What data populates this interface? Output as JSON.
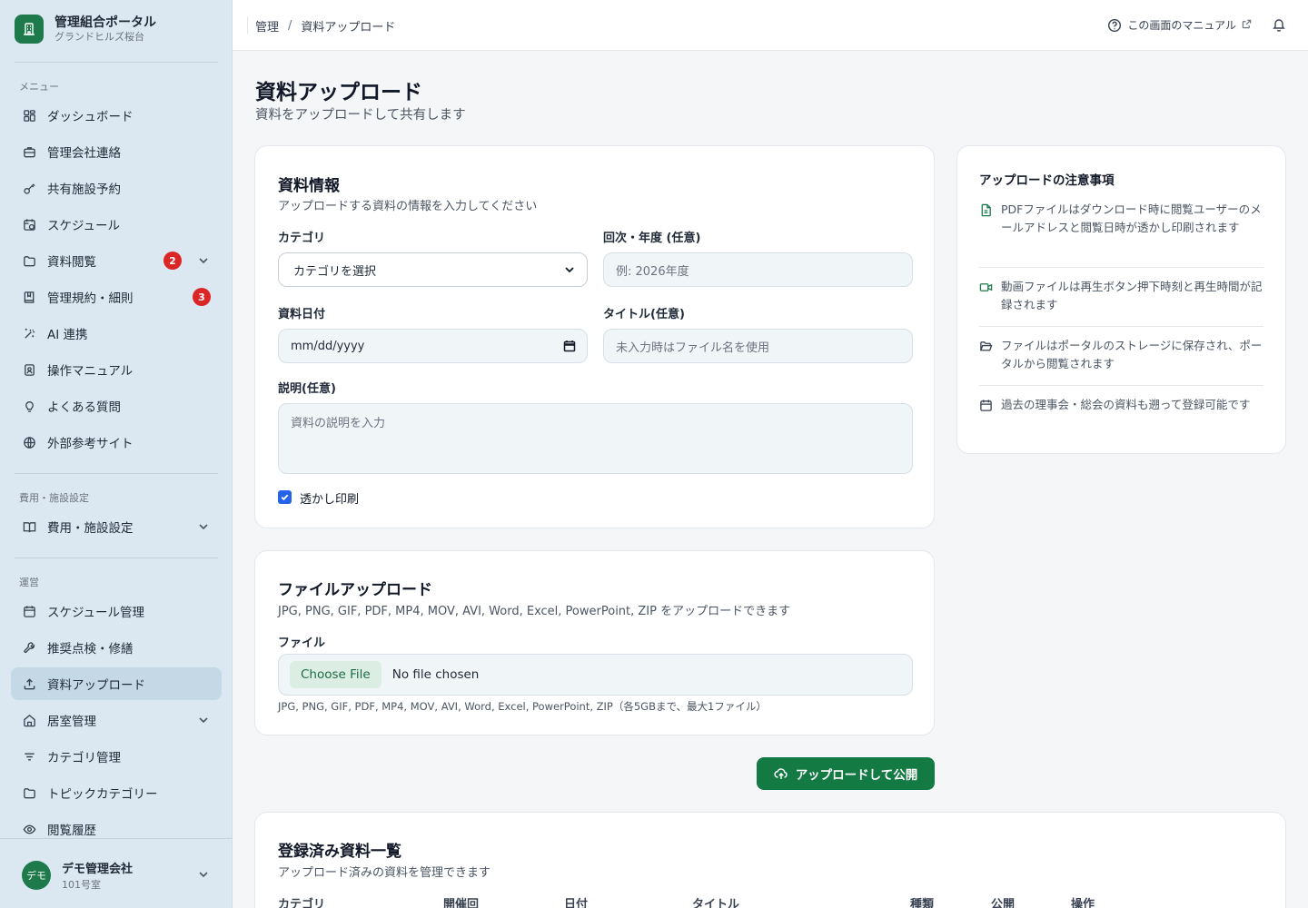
{
  "brand": {
    "title": "管理組合ポータル",
    "subtitle": "グランドヒルズ桜台"
  },
  "sidebar": {
    "section_menu": "メニュー",
    "section_fees": "費用・施設設定",
    "section_ops": "運営",
    "items": [
      {
        "label": "ダッシュボード",
        "icon": "grid-icon"
      },
      {
        "label": "管理会社連絡",
        "icon": "briefcase-icon"
      },
      {
        "label": "共有施設予約",
        "icon": "key-icon"
      },
      {
        "label": "スケジュール",
        "icon": "calendar-clock-icon"
      },
      {
        "label": "資料閲覧",
        "icon": "folder-icon",
        "badge": "2"
      },
      {
        "label": "管理規約・細則",
        "icon": "book-icon",
        "badge": "3"
      },
      {
        "label": "AI 連携",
        "icon": "sparkle-icon"
      },
      {
        "label": "操作マニュアル",
        "icon": "manual-icon"
      },
      {
        "label": "よくある質問",
        "icon": "lightbulb-icon"
      },
      {
        "label": "外部参考サイト",
        "icon": "globe-icon"
      },
      {
        "label": "費用・施設設定",
        "icon": "open-book-icon"
      },
      {
        "label": "スケジュール管理",
        "icon": "calendar-icon"
      },
      {
        "label": "推奨点検・修繕",
        "icon": "wrench-icon"
      },
      {
        "label": "資料アップロード",
        "icon": "upload-icon"
      },
      {
        "label": "居室管理",
        "icon": "home-icon"
      },
      {
        "label": "カテゴリ管理",
        "icon": "filter-icon"
      },
      {
        "label": "トピックカテゴリー",
        "icon": "folder-icon"
      },
      {
        "label": "閲覧履歴",
        "icon": "eye-icon"
      }
    ]
  },
  "user": {
    "avatar": "デモ",
    "name": "デモ管理会社",
    "room": "101号室"
  },
  "header": {
    "breadcrumb": [
      "管理",
      "資料アップロード"
    ],
    "breadcrumb_sep": "/",
    "manual_link": "この画面のマニュアル"
  },
  "page": {
    "title": "資料アップロード",
    "subtitle": "資料をアップロードして共有します"
  },
  "info_card": {
    "title": "資料情報",
    "desc": "アップロードする資料の情報を入力してください",
    "category_label": "カテゴリ",
    "category_value": "カテゴリを選択",
    "period_label": "回次・年度 (任意)",
    "period_placeholder": "例: 2026年度",
    "date_label": "資料日付",
    "date_value": "mm/dd/yyyy",
    "title_label": "タイトル(任意)",
    "title_placeholder": "未入力時はファイル名を使用",
    "desc_label": "説明(任意)",
    "desc_placeholder": "資料の説明を入力",
    "watermark_label": "透かし印刷",
    "watermark_checked": true
  },
  "file_card": {
    "title": "ファイルアップロード",
    "desc": "JPG, PNG, GIF, PDF, MP4, MOV, AVI, Word, Excel, PowerPoint, ZIP をアップロードできます",
    "file_label": "ファイル",
    "choose_button": "Choose File",
    "no_file": "No file chosen",
    "hint": "JPG, PNG, GIF, PDF, MP4, MOV, AVI, Word, Excel, PowerPoint, ZIP（各5GBまで、最大1ファイル）"
  },
  "publish_button": "アップロードして公開",
  "notes": {
    "title": "アップロードの注意事項",
    "items": [
      {
        "icon": "file-icon",
        "text": "PDFファイルはダウンロード時に閲覧ユーザーのメールアドレスと閲覧日時が透かし印刷されます"
      },
      {
        "icon": "video-icon",
        "text": "動画ファイルは再生ボタン押下時刻と再生時間が記録されます"
      },
      {
        "icon": "folder-open-icon",
        "text": "ファイルはポータルのストレージに保存され、ポータルから閲覧されます"
      },
      {
        "icon": "calendar-icon",
        "text": "過去の理事会・総会の資料も遡って登録可能です"
      }
    ]
  },
  "list_card": {
    "title": "登録済み資料一覧",
    "desc": "アップロード済みの資料を管理できます",
    "columns": [
      "カテゴリ",
      "開催回",
      "日付",
      "タイトル",
      "種類",
      "公開",
      "操作"
    ]
  },
  "colors": {
    "brand": "#1e7a4b",
    "primary_button": "#137a43",
    "badge": "#dc2626",
    "sidebar_bg": "#dbe8f1"
  }
}
